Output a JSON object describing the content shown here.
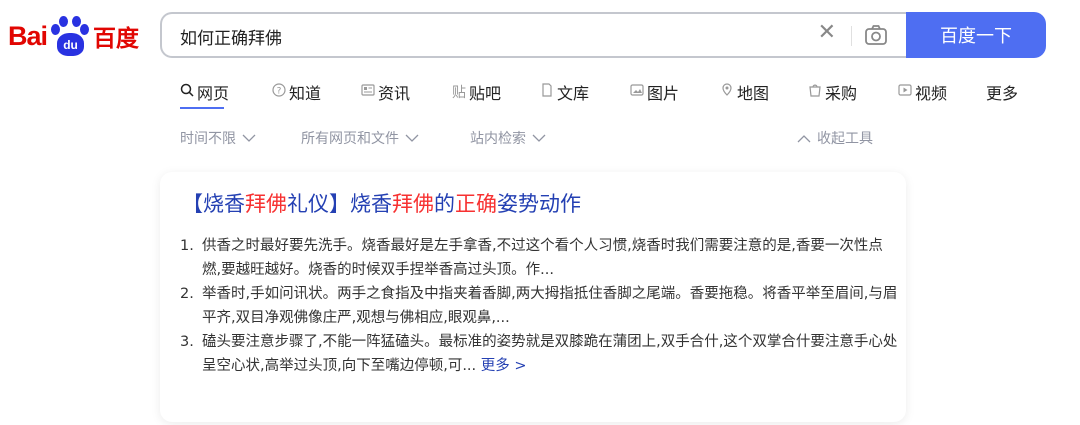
{
  "logo": {
    "text_left": "Bai",
    "text_paw": "du",
    "text_right": "百度"
  },
  "search": {
    "query": "如何正确拜佛",
    "button_label": "百度一下"
  },
  "tabs": [
    {
      "label": "网页",
      "icon": "search-icon",
      "active": true
    },
    {
      "label": "知道",
      "icon": "question-icon"
    },
    {
      "label": "资讯",
      "icon": "news-icon"
    },
    {
      "label": "贴吧",
      "icon": "tieba-icon"
    },
    {
      "label": "文库",
      "icon": "document-icon"
    },
    {
      "label": "图片",
      "icon": "image-icon"
    },
    {
      "label": "地图",
      "icon": "map-icon"
    },
    {
      "label": "采购",
      "icon": "shopping-icon"
    },
    {
      "label": "视频",
      "icon": "video-icon"
    },
    {
      "label": "更多"
    }
  ],
  "filters": {
    "time": "时间不限",
    "filetype": "所有网页和文件",
    "site": "站内检索",
    "collapse": "收起工具"
  },
  "result": {
    "title_parts": [
      {
        "t": "【烧香",
        "hl": false
      },
      {
        "t": "拜佛",
        "hl": true
      },
      {
        "t": "礼仪】烧香",
        "hl": false
      },
      {
        "t": "拜佛",
        "hl": true
      },
      {
        "t": "的",
        "hl": false
      },
      {
        "t": "正确",
        "hl": true
      },
      {
        "t": "姿势动作",
        "hl": false
      }
    ],
    "items": [
      {
        "num": "1.",
        "text": "供香之时最好要先洗手。烧香最好是左手拿香,不过这个看个人习惯,烧香时我们需要注意的是,香要一次性点燃,要越旺越好。烧香的时候双手捏举香高过头顶。作..."
      },
      {
        "num": "2.",
        "text": "举香时,手如问讯状。两手之食指及中指夹着香脚,两大拇指抵住香脚之尾端。香要拖稳。将香平举至眉间,与眉平齐,双目净观佛像庄严,观想与佛相应,眼观鼻,..."
      },
      {
        "num": "3.",
        "text": "磕头要注意步骤了,不能一阵猛磕头。最标准的姿势就是双膝跪在蒲团上,双手合什,这个双掌合什要注意手心处呈空心状,高举过头顶,向下至嘴边停顿,可..."
      }
    ],
    "more_label": "更多 >"
  }
}
